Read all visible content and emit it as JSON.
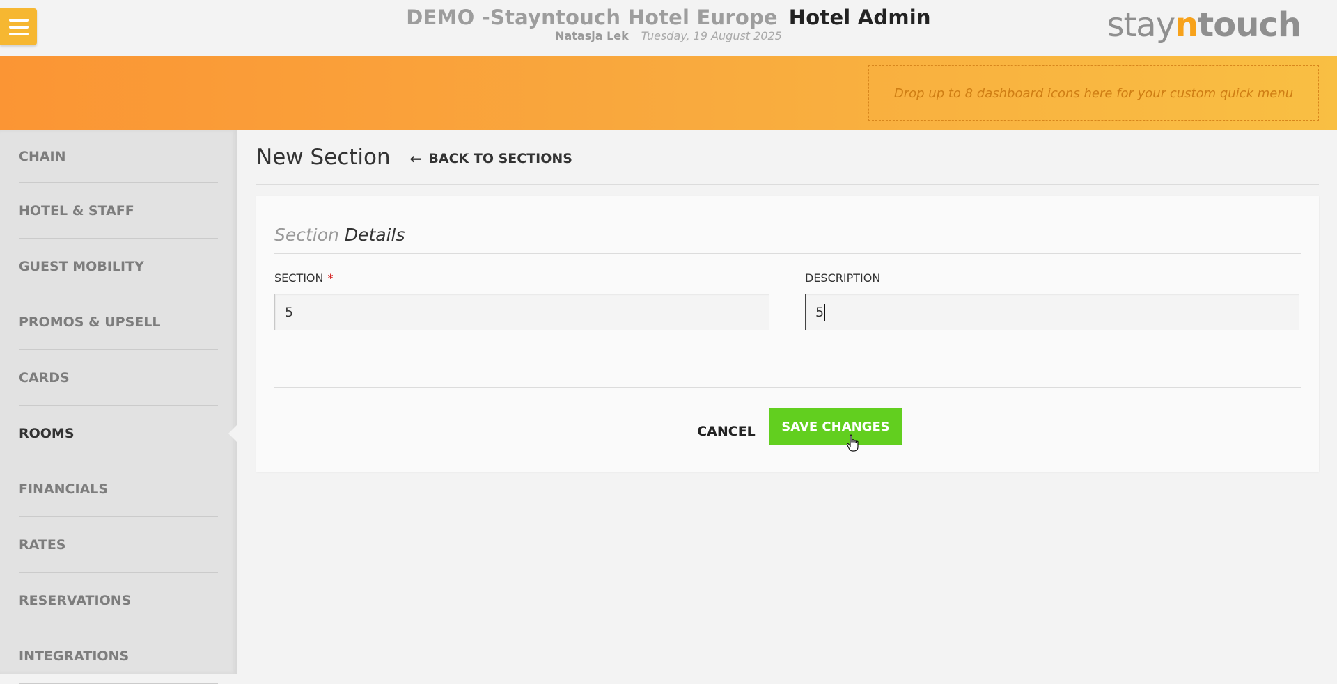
{
  "header": {
    "hotel_name": "DEMO -Stayntouch Hotel Europe",
    "app_name": "Hotel Admin",
    "user_name": "Natasja Lek",
    "date": "Tuesday, 19 August 2025",
    "logo": {
      "part1": "stay",
      "part2": "n",
      "part3": "touch"
    },
    "menu_icon": "hamburger-icon"
  },
  "quick_menu": {
    "placeholder": "Drop up to 8 dashboard icons here for your custom quick menu"
  },
  "sidebar": {
    "items": [
      {
        "label": "CHAIN"
      },
      {
        "label": "HOTEL & STAFF"
      },
      {
        "label": "GUEST MOBILITY"
      },
      {
        "label": "PROMOS & UPSELL"
      },
      {
        "label": "CARDS"
      },
      {
        "label": "ROOMS",
        "active": true
      },
      {
        "label": "FINANCIALS"
      },
      {
        "label": "RATES"
      },
      {
        "label": "RESERVATIONS"
      },
      {
        "label": "INTEGRATIONS"
      }
    ]
  },
  "main": {
    "title": "New Section",
    "back_label": "BACK TO SECTIONS",
    "back_icon": "arrow-left-icon",
    "card": {
      "heading_light": "Section",
      "heading_dark": "Details",
      "fields": {
        "section": {
          "label": "SECTION",
          "required_mark": "*",
          "value": "5"
        },
        "description": {
          "label": "DESCRIPTION",
          "value": "5"
        }
      },
      "cancel_label": "CANCEL",
      "save_label": "SAVE CHANGES"
    }
  },
  "colors": {
    "accent_orange": "#f9a73d",
    "save_green": "#62cf1f",
    "menu_yellow": "#f6b731"
  }
}
